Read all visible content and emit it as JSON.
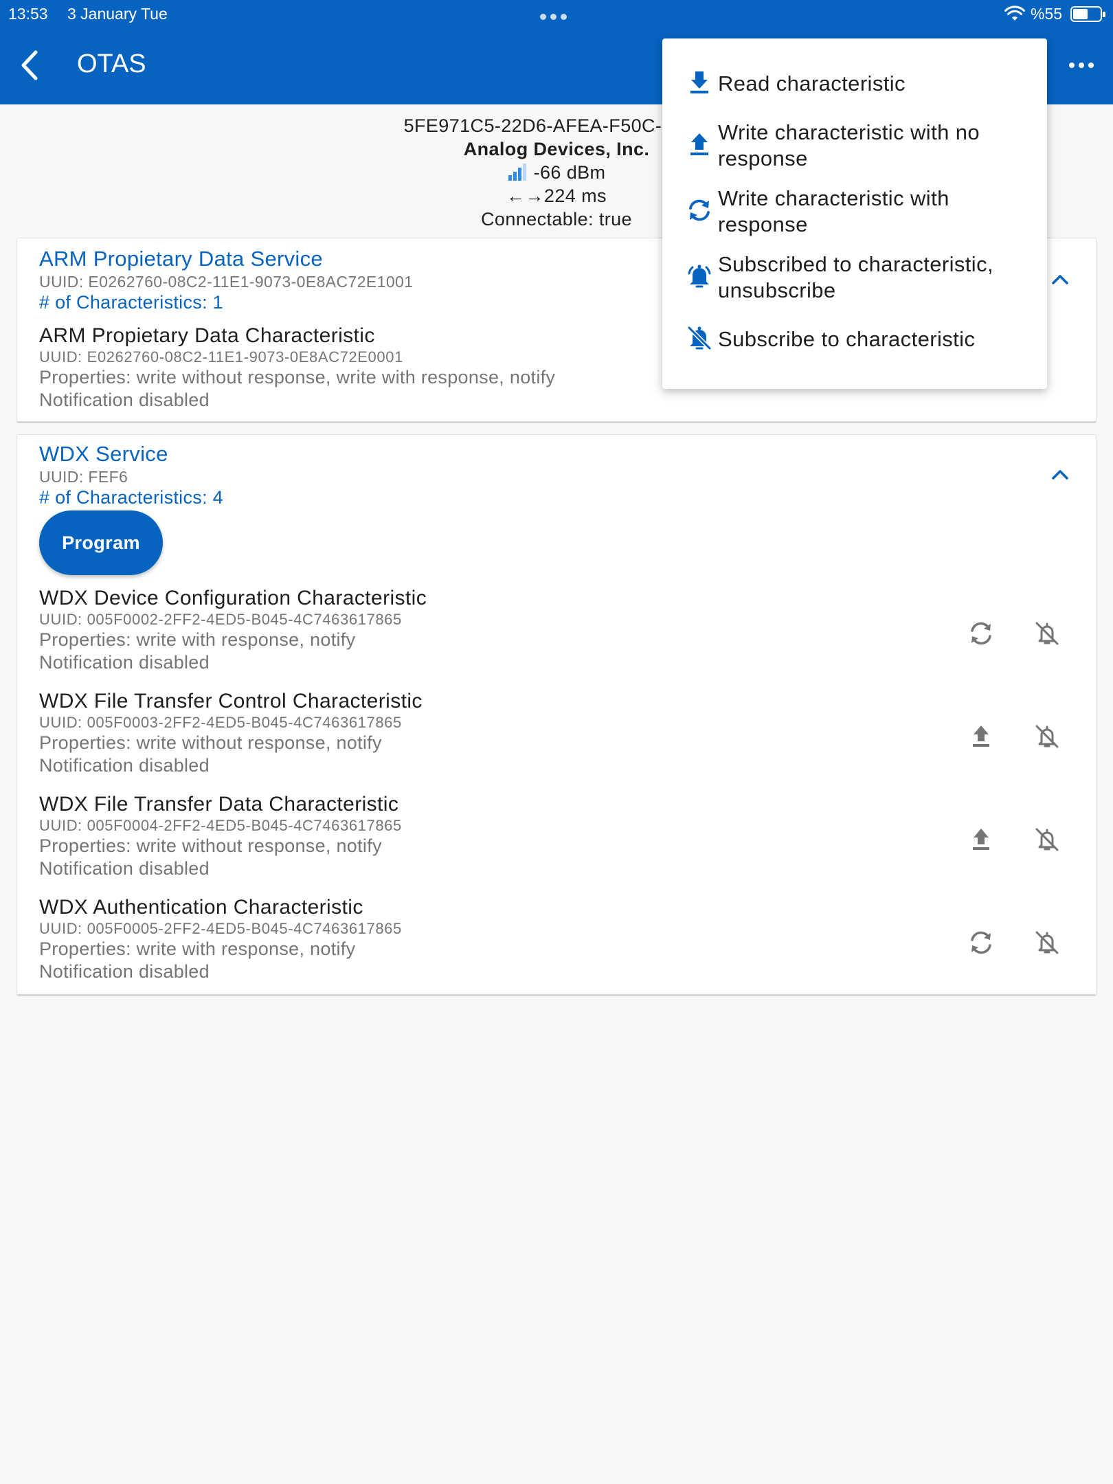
{
  "status_bar": {
    "time": "13:53",
    "date": "3 January Tue",
    "battery_text": "%55",
    "battery_level": 0.55
  },
  "header": {
    "title": "OTAS"
  },
  "device": {
    "address": "5FE971C5-22D6-AFEA-F50C-F8CF",
    "company": "Analog Devices, Inc.",
    "rssi": "-66 dBm",
    "interval": "224 ms",
    "interval_arrows": "←→",
    "connectable": "Connectable: true"
  },
  "services": [
    {
      "name": "ARM Propietary Data Service",
      "uuid": "UUID: E0262760-08C2-11E1-9073-0E8AC72E1001",
      "count": "# of Characteristics: 1",
      "characteristics": [
        {
          "name": "ARM Propietary Data Characteristic",
          "uuid": "UUID: E0262760-08C2-11E1-9073-0E8AC72E0001",
          "properties": "Properties: write without response, write with response, notify",
          "notification": "Notification disabled"
        }
      ]
    },
    {
      "name": "WDX Service",
      "uuid": "UUID: FEF6",
      "count": "# of Characteristics: 4",
      "program_label": "Program",
      "characteristics": [
        {
          "name": "WDX Device Configuration Characteristic",
          "uuid": "UUID: 005F0002-2FF2-4ED5-B045-4C7463617865",
          "properties": "Properties: write with response, notify",
          "notification": "Notification disabled",
          "action_icon": "sync-icon"
        },
        {
          "name": "WDX File Transfer Control Characteristic",
          "uuid": "UUID: 005F0003-2FF2-4ED5-B045-4C7463617865",
          "properties": "Properties: write without response, notify",
          "notification": "Notification disabled",
          "action_icon": "upload-icon"
        },
        {
          "name": "WDX File Transfer Data Characteristic",
          "uuid": "UUID: 005F0004-2FF2-4ED5-B045-4C7463617865",
          "properties": "Properties: write without response, notify",
          "notification": "Notification disabled",
          "action_icon": "upload-icon"
        },
        {
          "name": "WDX Authentication Characteristic",
          "uuid": "UUID: 005F0005-2FF2-4ED5-B045-4C7463617865",
          "properties": "Properties: write with response, notify",
          "notification": "Notification disabled",
          "action_icon": "sync-icon"
        }
      ]
    }
  ],
  "menu": {
    "items": [
      {
        "label": "Read characteristic",
        "icon": "download-icon"
      },
      {
        "label": "Write characteristic with no response",
        "icon": "upload-icon"
      },
      {
        "label": "Write characteristic with response",
        "icon": "sync-icon"
      },
      {
        "label": "Subscribed to characteristic, unsubscribe",
        "icon": "bell-ringing-icon"
      },
      {
        "label": "Subscribe to characteristic",
        "icon": "bell-off-icon"
      }
    ]
  },
  "colors": {
    "primary": "#0763c0",
    "icon_gray": "#757575",
    "background": "#f7f7f7"
  }
}
